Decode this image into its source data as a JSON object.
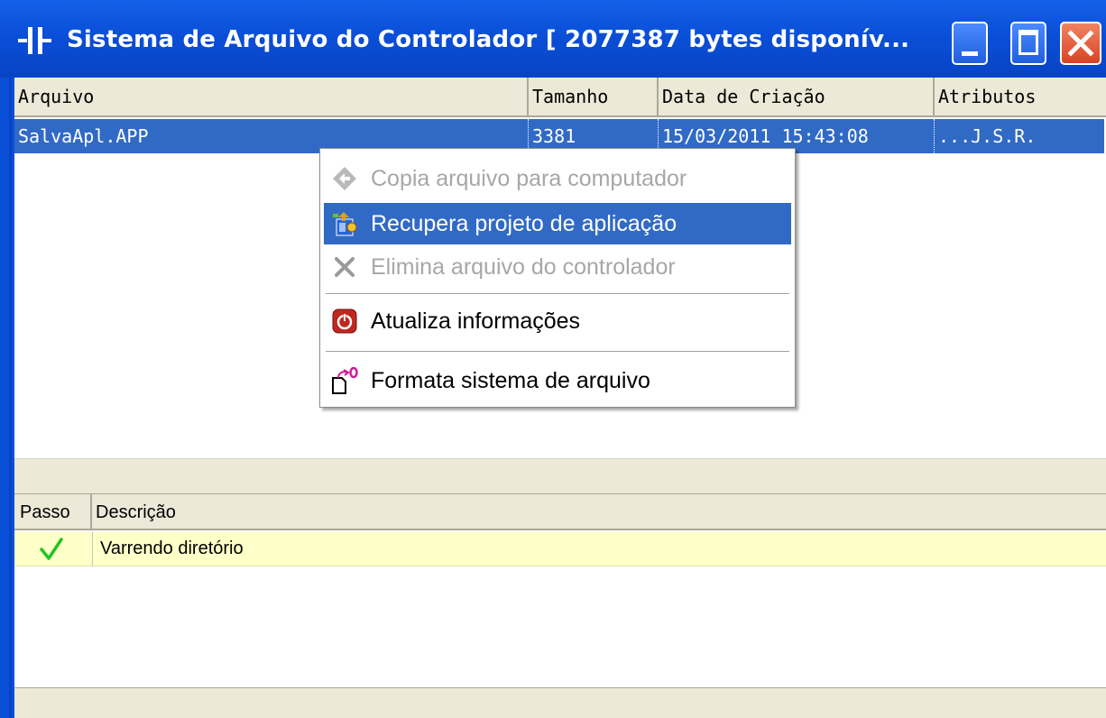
{
  "window": {
    "title": "Sistema de Arquivo do Controlador [ 2077387 bytes disponív...",
    "icon": "controller-app-icon",
    "buttons": {
      "minimize": "minimize-icon",
      "maximize": "maximize-icon",
      "close": "close-icon"
    }
  },
  "files": {
    "columns": [
      "Arquivo",
      "Tamanho",
      "Data de Criação",
      "Atributos"
    ],
    "rows": [
      {
        "name": "SalvaApl.APP",
        "size": "3381",
        "created": "15/03/2011 15:43:08",
        "attributes": "...J.S.R."
      }
    ]
  },
  "context_menu": {
    "items": [
      {
        "label": "Copia arquivo para computador",
        "icon": "copy-to-computer-icon",
        "enabled": false
      },
      {
        "label": "Recupera projeto de aplicação",
        "icon": "recover-project-icon",
        "enabled": true,
        "highlighted": true
      },
      {
        "label": "Elimina arquivo do controlador",
        "icon": "delete-x-icon",
        "enabled": false
      },
      {
        "label": "Atualiza informações",
        "icon": "refresh-power-icon",
        "enabled": true
      },
      {
        "label": "Formata sistema de arquivo",
        "icon": "format-filesystem-icon",
        "enabled": true
      }
    ]
  },
  "log": {
    "columns": [
      "Passo",
      "Descrição"
    ],
    "rows": [
      {
        "status_icon": "checkmark-icon",
        "description": "Varrendo diretório"
      }
    ]
  },
  "colors": {
    "titlebar": "#0a4fd8",
    "selection": "#316ac5",
    "log_row": "#ffffc8",
    "check": "#22c422"
  }
}
